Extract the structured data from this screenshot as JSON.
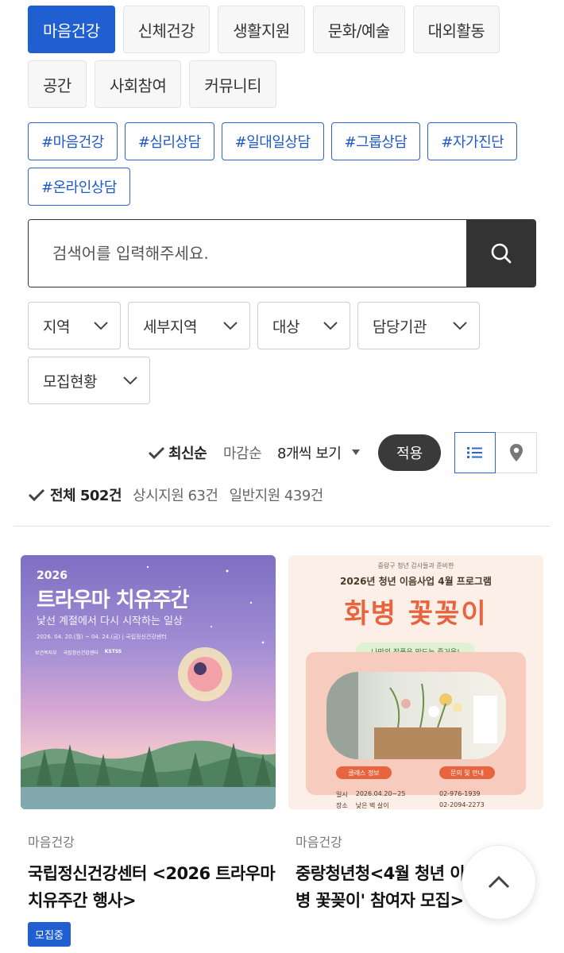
{
  "categories": [
    {
      "label": "마음건강",
      "active": true
    },
    {
      "label": "신체건강"
    },
    {
      "label": "생활지원"
    },
    {
      "label": "문화/예술"
    },
    {
      "label": "대외활동"
    },
    {
      "label": "공간"
    },
    {
      "label": "사회참여"
    },
    {
      "label": "커뮤니티"
    }
  ],
  "tags": [
    "#마음건강",
    "#심리상담",
    "#일대일상담",
    "#그룹상담",
    "#자가진단",
    "#온라인상담"
  ],
  "search": {
    "placeholder": "검색어를 입력해주세요.",
    "button_icon": "search-icon"
  },
  "filters": [
    "지역",
    "세부지역",
    "대상",
    "담당기관",
    "모집현황"
  ],
  "sort": {
    "newest": "최신순",
    "deadline": "마감순",
    "per_page": "8개씩 보기",
    "apply": "적용"
  },
  "counts": {
    "total": "전체 502건",
    "always": "상시지원 63건",
    "general": "일반지원 439건"
  },
  "cards": [
    {
      "category": "마음건강",
      "title": "국립정신건강센터 <2026 트라우마 치유주간 행사>",
      "badge": "모집중",
      "image": {
        "year": "2026",
        "headline": "트라우마 치유주간",
        "subline": "낯선 계절에서 다시 시작하는 일상",
        "dates": "2026. 04. 20.(월) ~ 04. 24.(금) | 국립정신건강센터",
        "logos": [
          "보건복지부",
          "국립정신건강센터",
          "KSTSS"
        ]
      }
    },
    {
      "category": "마음건강",
      "title": "중랑청년청<4월 청년 이음사업 '화병 꽃꽂이' 참여자 모집>",
      "image": {
        "top_line": "중랑구 청년 감사들과 준비한",
        "program": "2026년 청년 이음사업 4월 프로그램",
        "headline": "화병 꽃꽂이",
        "pill": "나만의 작품을 만드는 즐거움!",
        "info_left": "클래스 정보",
        "info_right": "문의 및 안내",
        "date_label": "일시",
        "date": "2026.04.20~25",
        "place_label": "장소",
        "place": "낮은 벽 살이",
        "phone1": "02-976-1939",
        "phone2": "02-2094-2273"
      }
    }
  ],
  "scroll_top": {
    "icon": "chevron-up-icon"
  },
  "colors": {
    "primary": "#1f5fd1",
    "dark": "#333333",
    "card1_sky": "#8f7fc9",
    "card2_bg": "#fbefe7",
    "card2_title": "#e8643f"
  }
}
